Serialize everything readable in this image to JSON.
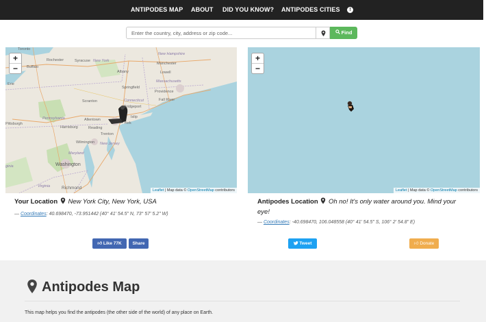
{
  "nav": {
    "items": [
      "ANTIPODES MAP",
      "ABOUT",
      "DID YOU KNOW?",
      "ANTIPODES CITIES"
    ],
    "info_icon": "info-circle-icon"
  },
  "search": {
    "placeholder": "Enter the country, city, address or zip code...",
    "value": "",
    "locate_icon": "map-marker-icon",
    "find_label": "Find",
    "find_icon": "search-icon"
  },
  "map_left": {
    "zoom_in": "+",
    "zoom_out": "−",
    "labels": [
      "Toronto",
      "Rochester",
      "Syracuse",
      "New York",
      "New Hampshire",
      "Manchester",
      "Albany",
      "Lowell",
      "Buffalo",
      "Erie",
      "Massachusetts",
      "Springfield",
      "Providence",
      "Scranton",
      "Connecticut",
      "Fall River",
      "Bridgeport",
      "Pittsburgh",
      "Pennsylvania",
      "Allentown",
      "Islip",
      "York",
      "Harrisburg",
      "Reading",
      "Trenton",
      "Wilmington",
      "New Jersey",
      "Maryland",
      "Washington",
      "Virginia",
      "Richmond",
      "ginia"
    ],
    "attribution": {
      "leaflet": "Leaflet",
      "text": " | Map data © ",
      "osm": "OpenStreetMap",
      "suffix": " contributors"
    }
  },
  "map_right": {
    "zoom_in": "+",
    "zoom_out": "−",
    "attribution": {
      "leaflet": "Leaflet",
      "text": " | Map data © ",
      "osm": "OpenStreetMap",
      "suffix": " contributors"
    }
  },
  "your_location": {
    "label": "Your Location",
    "place": "New York City, New York, USA",
    "coords_prefix": "— ",
    "coords_link": "Coordinates",
    "coords_value": ": 40.698470, -73.951442 (40° 41' 54.5\" N, 73° 57' 5.2\" W)"
  },
  "antipodes_location": {
    "label": "Antipodes Location",
    "place_line1": "Oh no! It's only water around you. Mind your",
    "place_line2": "eye!",
    "coords_prefix": "— ",
    "coords_link": "Coordinates",
    "coords_value": ": -40.698470, 106.048558 (40° 41' 54.5\" S, 106° 2' 54.8\" E)"
  },
  "social": {
    "like_label": "Like 77K",
    "share_label": "Share",
    "tweet_label": "Tweet",
    "donate_label": "Donate"
  },
  "about": {
    "title": "Antipodes Map",
    "text": "This map helps you find the antipodes (the other side of the world) of any place on Earth."
  },
  "colors": {
    "navbar": "#222222",
    "find": "#5cb85c",
    "facebook": "#4267b2",
    "tweet": "#1da1f2",
    "donate": "#f0ad4e",
    "ocean": "#aad3df"
  }
}
